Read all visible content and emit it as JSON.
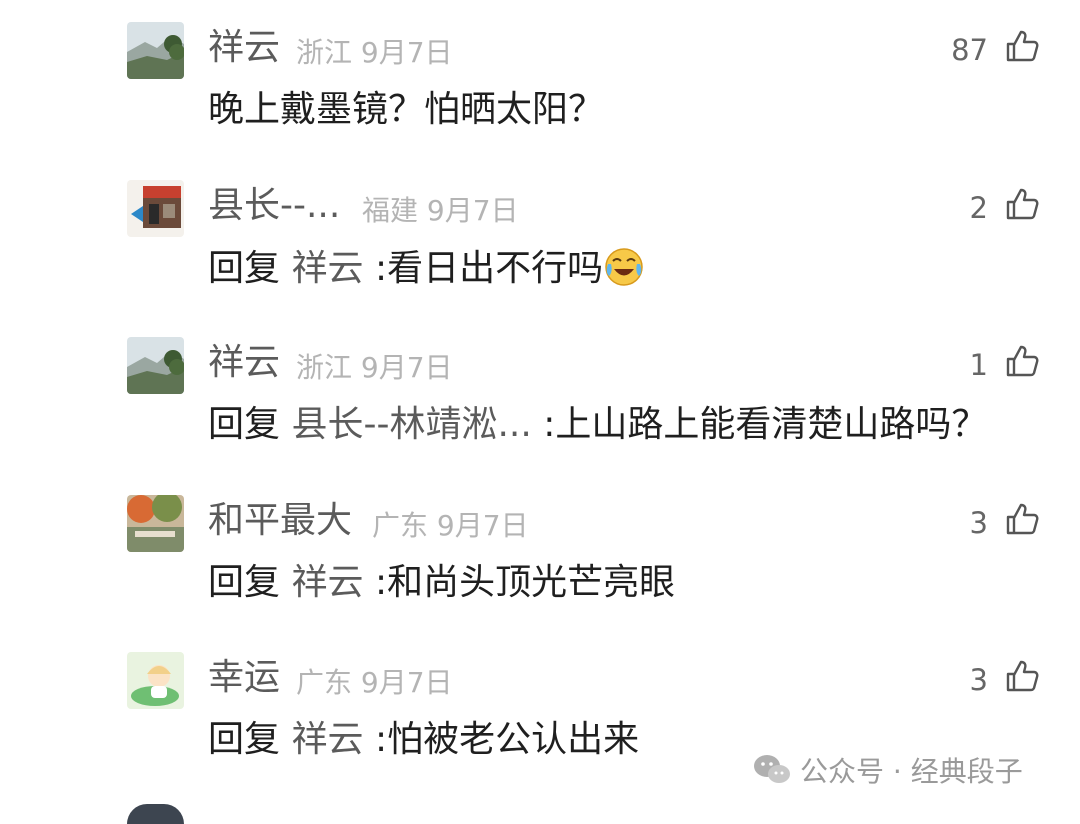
{
  "comments": [
    {
      "name": "祥云",
      "location": "浙江",
      "date": "9月7日",
      "likes": "87",
      "text": "晚上戴墨镜？怕晒太阳？",
      "avatar_icon": "mountain-landscape-avatar"
    },
    {
      "name": "县长--...",
      "location": "福建",
      "date": "9月7日",
      "likes": "2",
      "reply_label": "回复",
      "reply_to": "祥云",
      "text": ":看日出不行吗",
      "emoji": "face-with-tears-of-joy",
      "avatar_icon": "storefront-avatar"
    },
    {
      "name": "祥云",
      "location": "浙江",
      "date": "9月7日",
      "likes": "1",
      "reply_label": "回复",
      "reply_to": "县长--林靖淞...",
      "text": ":上山路上能看清楚山路吗？",
      "avatar_icon": "mountain-landscape-avatar"
    },
    {
      "name": "和平最大",
      "location": "广东",
      "date": "9月7日",
      "likes": "3",
      "reply_label": "回复",
      "reply_to": "祥云",
      "text": ":和尚头顶光芒亮眼",
      "avatar_icon": "autumn-garden-avatar"
    },
    {
      "name": "幸运",
      "location": "广东",
      "date": "9月7日",
      "likes": "3",
      "reply_label": "回复",
      "reply_to": "祥云",
      "text": ":怕被老公认出来",
      "avatar_icon": "cartoon-child-avatar"
    }
  ],
  "watermark": {
    "text": "公众号 · 经典段子",
    "icon": "wechat-icon"
  },
  "colors": {
    "name": "#5b5b5b",
    "meta": "#b4b4b4",
    "body": "#1f1f1f"
  }
}
